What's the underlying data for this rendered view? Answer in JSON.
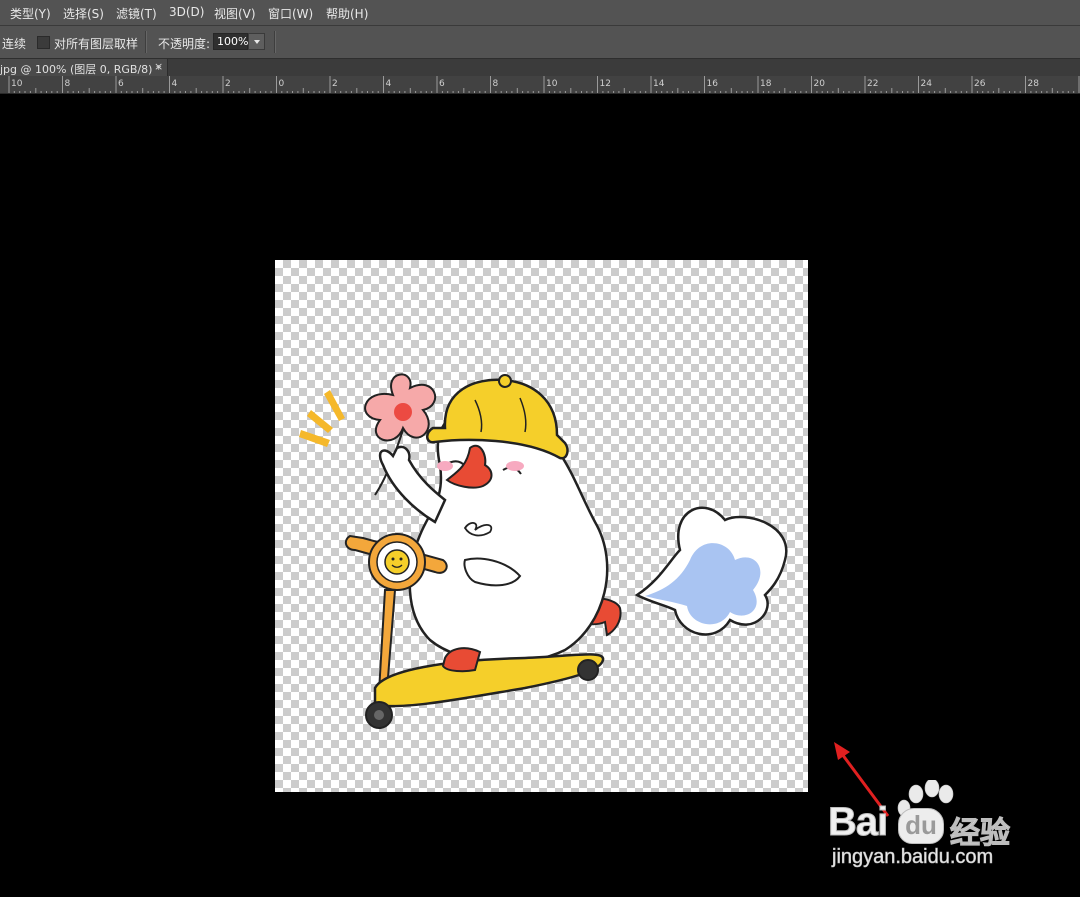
{
  "menu": {
    "items": [
      "类型(Y)",
      "选择(S)",
      "滤镜(T)",
      "3D(D)",
      "视图(V)",
      "窗口(W)",
      "帮助(H)"
    ]
  },
  "options": {
    "continuous_label": "连续",
    "sample_all_layers_label": "对所有图层取样",
    "opacity_label": "不透明度:",
    "opacity_value": "100%"
  },
  "document": {
    "tab_title": "jpg @ 100% (图层 0, RGB/8) *",
    "close_glyph": "×"
  },
  "ruler": {
    "labels": [
      "10",
      "8",
      "6",
      "4",
      "2",
      "0",
      "2",
      "4",
      "6",
      "8",
      "10",
      "12",
      "14",
      "16",
      "18",
      "20",
      "22",
      "24",
      "26",
      "28"
    ]
  },
  "canvas": {
    "background": "#000000",
    "content_icon": "snowman-on-scooter-sticker",
    "transparency": "checkerboard"
  },
  "watermark": {
    "brand_part1": "Bai",
    "brand_part2": "du",
    "brand_cn": "经验",
    "url": "jingyan.baidu.com"
  },
  "colors": {
    "menubar": "#535353",
    "arrow": "#e02020",
    "helmet": "#f5cf2a",
    "scooter": "#f3a73b",
    "cloud": "#a9c4f2"
  }
}
